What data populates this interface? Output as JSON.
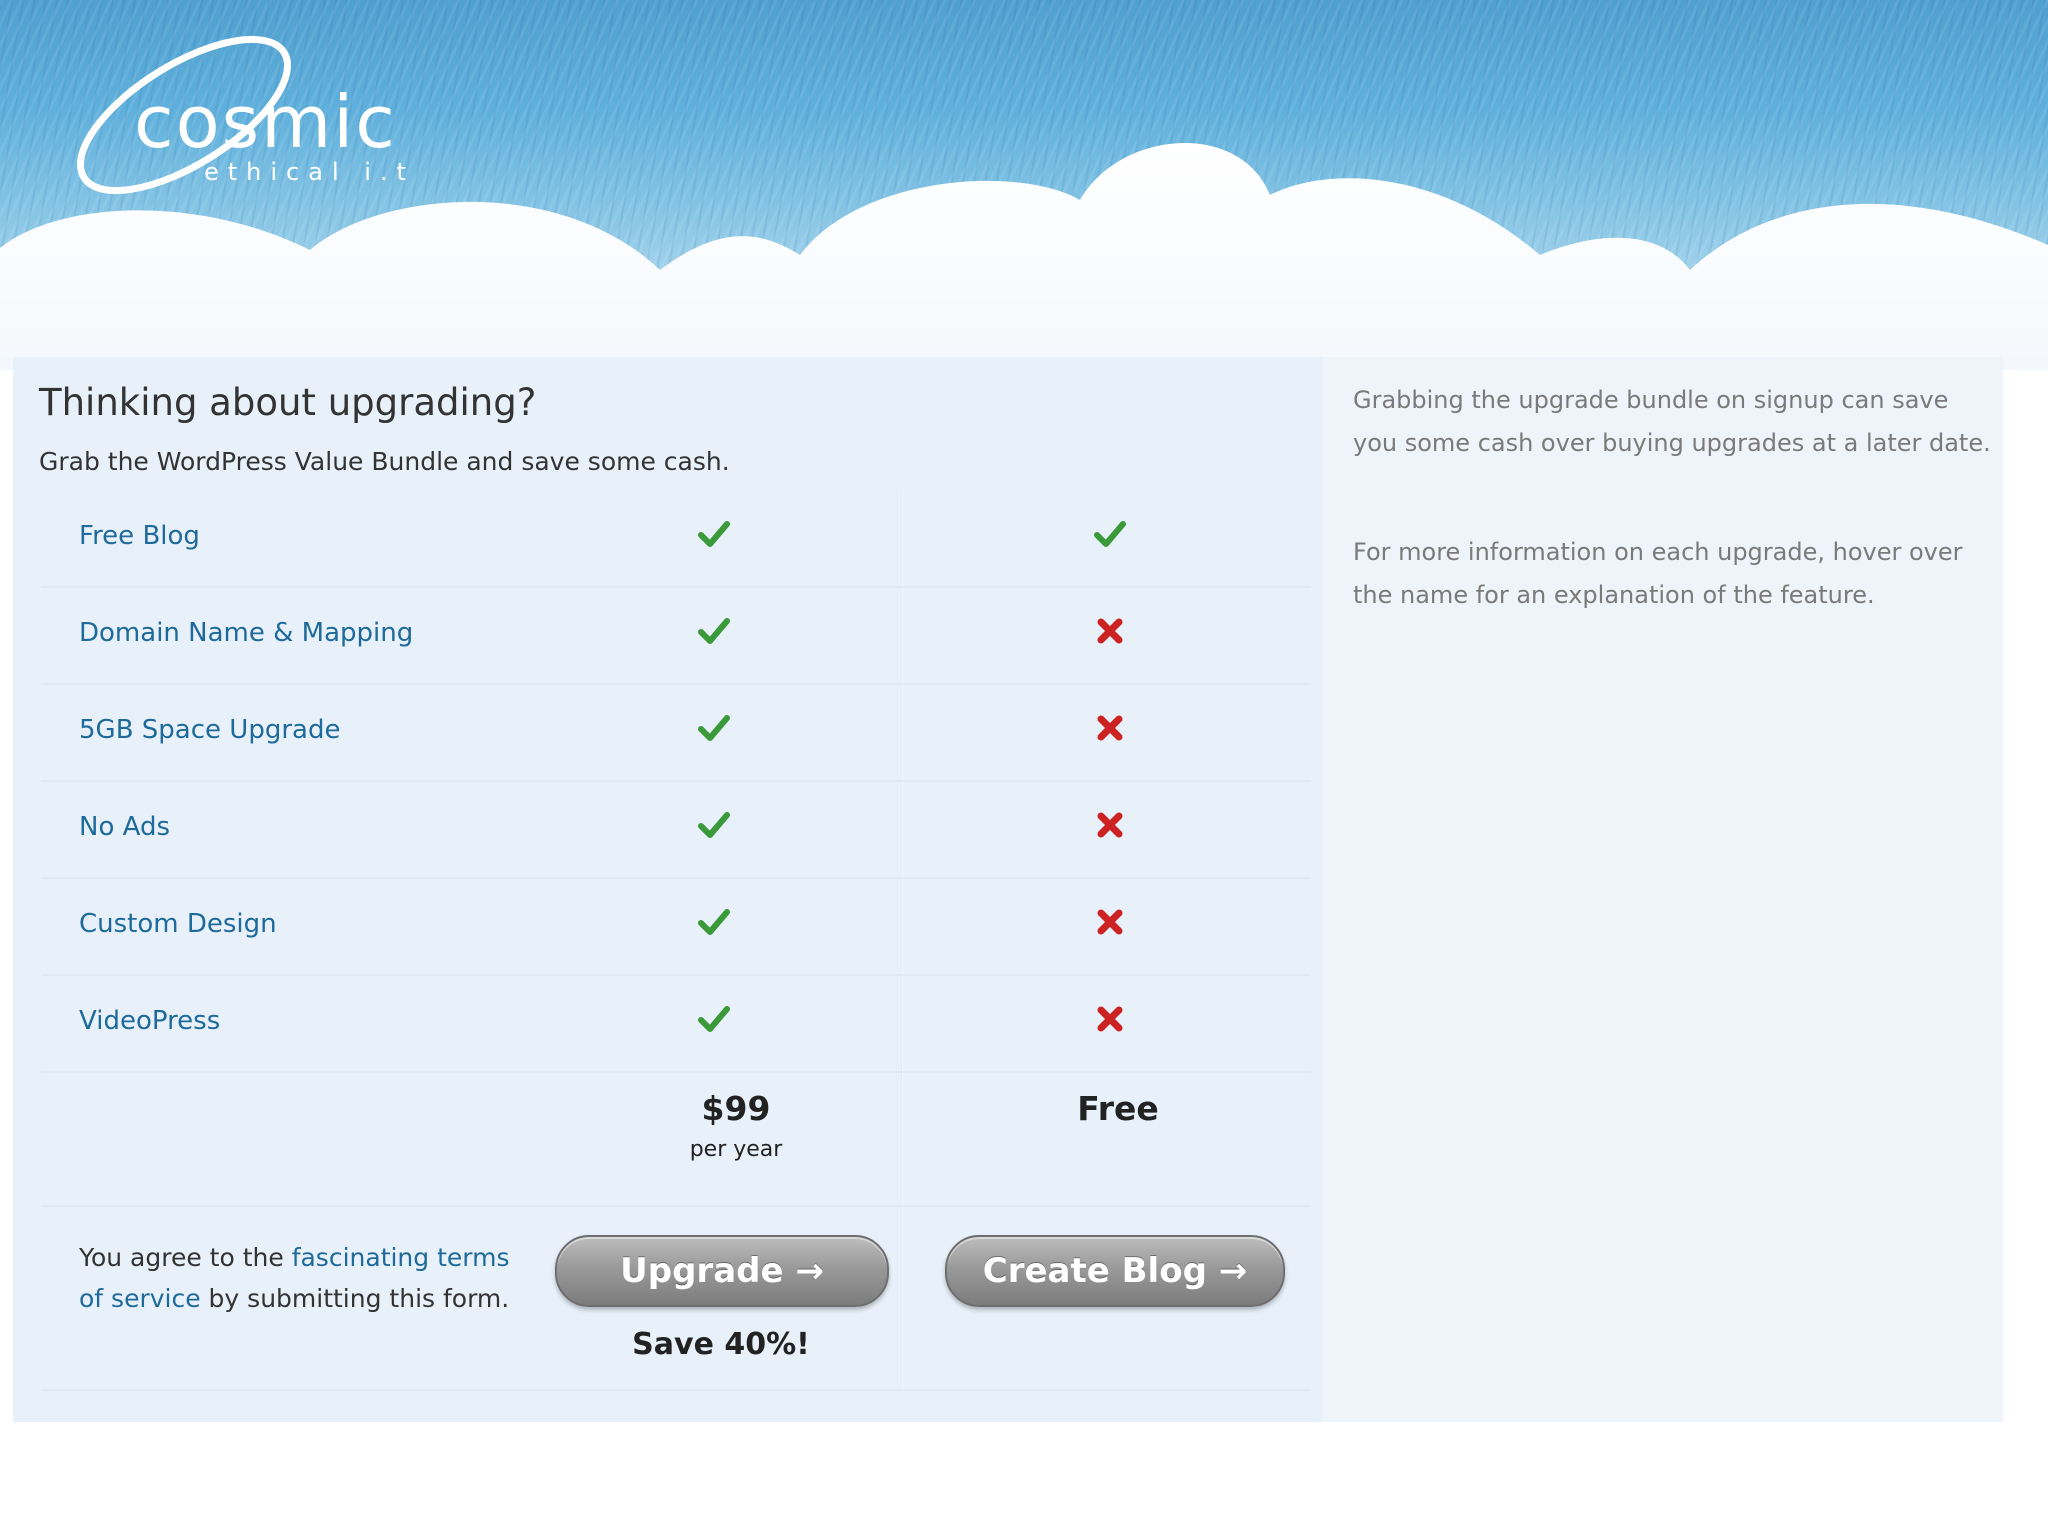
{
  "header": {
    "logo_word": "cosmic",
    "logo_sub": "ethical i.t"
  },
  "main": {
    "title": "Thinking about upgrading?",
    "subtitle": "Grab the WordPress Value Bundle and save some cash.",
    "features": [
      {
        "label": "Free Blog",
        "bundle": "check",
        "free": "check"
      },
      {
        "label": "Domain Name & Mapping",
        "bundle": "check",
        "free": "cross"
      },
      {
        "label": "5GB Space Upgrade",
        "bundle": "check",
        "free": "cross"
      },
      {
        "label": "No Ads",
        "bundle": "check",
        "free": "cross"
      },
      {
        "label": "Custom Design",
        "bundle": "check",
        "free": "cross"
      },
      {
        "label": "VideoPress",
        "bundle": "check",
        "free": "cross"
      }
    ],
    "price": "$99",
    "price_period": "per year",
    "free_price": "Free",
    "terms": {
      "prefix": "You agree to the ",
      "link": "fascinating terms of service",
      "suffix": " by submitting this form."
    },
    "upgrade_button": "Upgrade →",
    "create_button": "Create Blog →",
    "save_text": "Save 40%!"
  },
  "sidebar": {
    "p1": "Grabbing the upgrade bundle on signup can save you some cash over buying upgrades at a later date.",
    "p2": "For more information on each upgrade, hover over the name for an explanation of the feature."
  },
  "colors": {
    "check": "#3a9a3a",
    "cross": "#cc2222",
    "link": "#1e6a9a"
  },
  "icons": {
    "check": "checkmark-icon",
    "cross": "cross-icon"
  }
}
